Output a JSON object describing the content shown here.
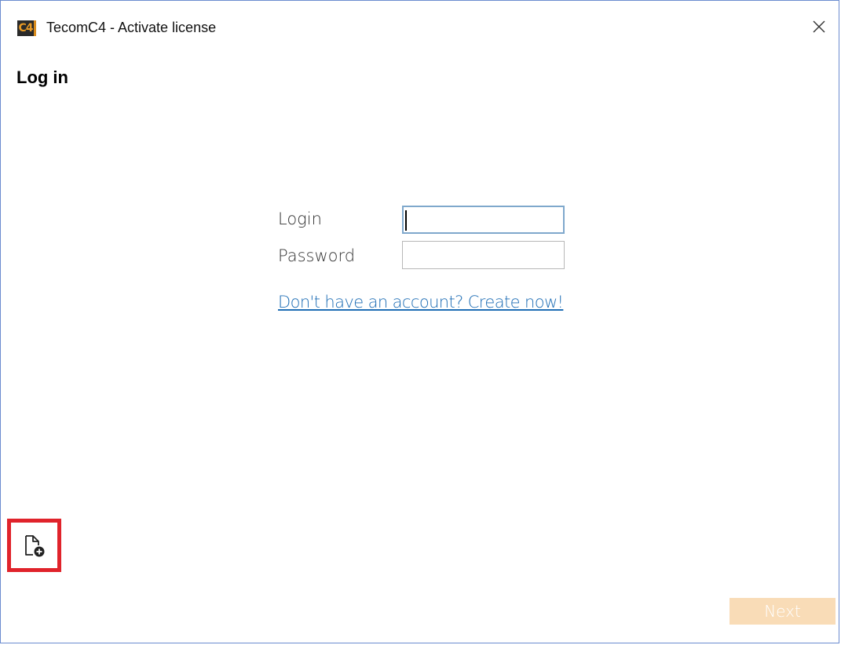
{
  "window": {
    "logo_text": "C4",
    "title": "TecomC4 - Activate license",
    "close_icon": "close-icon"
  },
  "page": {
    "heading": "Log in"
  },
  "form": {
    "login_label": "Login",
    "login_value": "",
    "password_label": "Password",
    "password_value": "",
    "create_account_link": "Don't have an account? Create now!"
  },
  "footer": {
    "add_file_icon": "add-file-icon",
    "next_label": "Next",
    "next_enabled": false
  },
  "colors": {
    "window_border": "#6b8ccf",
    "highlight": "#e0232b",
    "link": "#1f6eb5",
    "next_disabled_bg": "#f9dcb7",
    "logo_accent": "#d98c1d"
  }
}
